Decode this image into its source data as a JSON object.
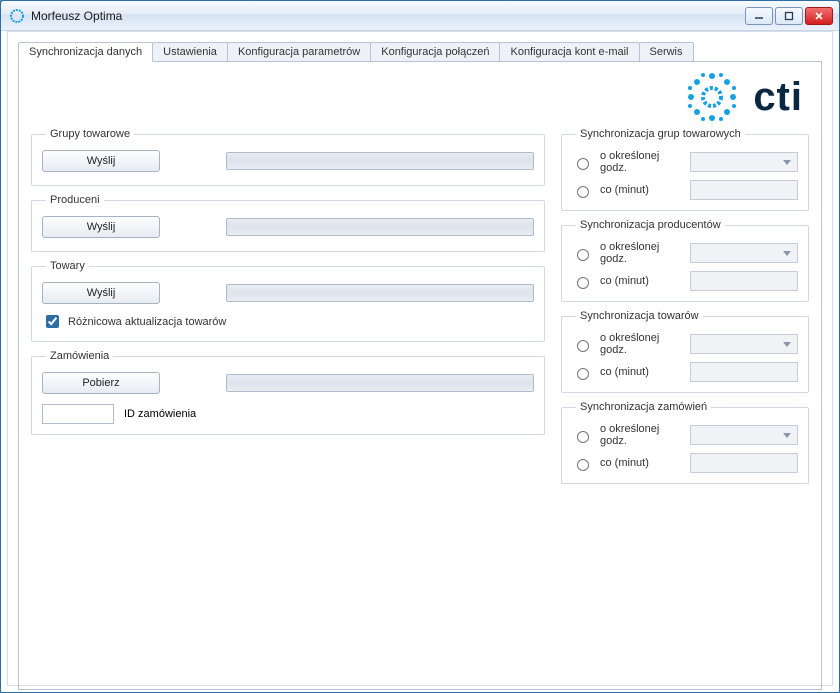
{
  "window": {
    "title": "Morfeusz Optima"
  },
  "tabs": [
    "Synchronizacja danych",
    "Ustawienia",
    "Konfiguracja parametrów",
    "Konfiguracja połączeń",
    "Konfiguracja kont e-mail",
    "Serwis"
  ],
  "active_tab_index": 0,
  "logo_text": "cti",
  "left": {
    "groups": {
      "legend": "Grupy towarowe",
      "button": "Wyślij"
    },
    "producers": {
      "legend": "Produceni",
      "button": "Wyślij"
    },
    "goods": {
      "legend": "Towary",
      "button": "Wyślij",
      "diff_checkbox_label": "Różnicowa aktualizacja towarów",
      "diff_checked": true
    },
    "orders": {
      "legend": "Zamówienia",
      "button": "Pobierz",
      "id_label": "ID zamówienia",
      "id_value": ""
    }
  },
  "right": {
    "groups": {
      "legend": "Synchronizacja grup towarowych",
      "opt_time": "o określonej godz.",
      "opt_interval": "co (minut)"
    },
    "producers": {
      "legend": "Synchronizacja producentów",
      "opt_time": "o określonej godz.",
      "opt_interval": "co (minut)"
    },
    "goods": {
      "legend": "Synchronizacja towarów",
      "opt_time": "o określonej godz.",
      "opt_interval": "co (minut)"
    },
    "orders": {
      "legend": "Synchronizacja zamówień",
      "opt_time": "o określonej godz.",
      "opt_interval": "co (minut)"
    }
  }
}
